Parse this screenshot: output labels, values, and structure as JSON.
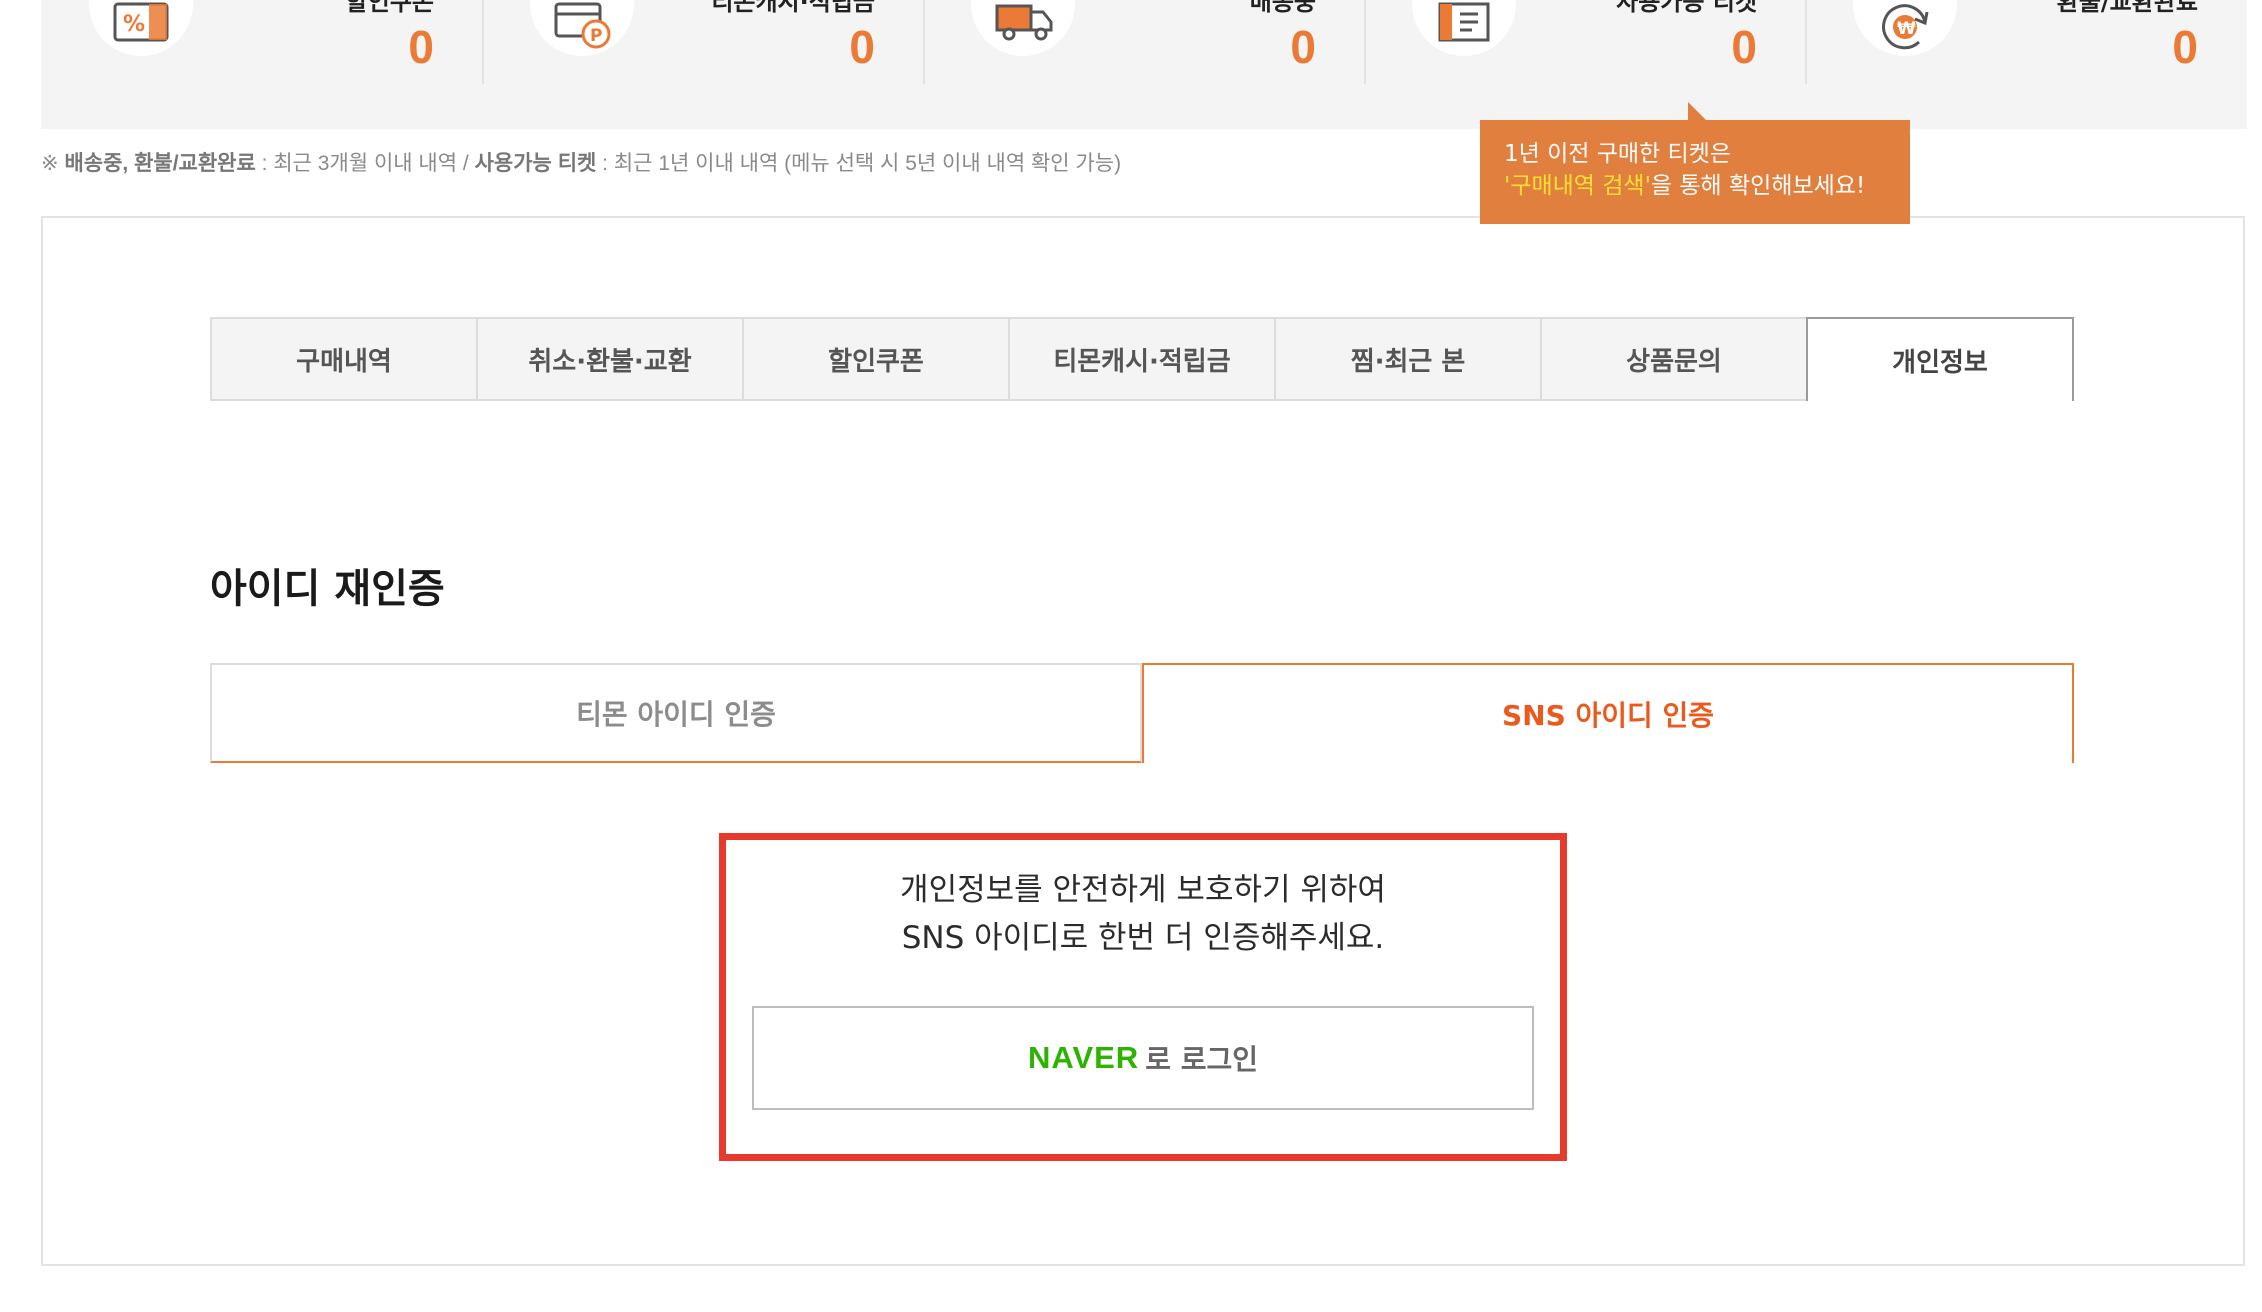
{
  "stats": [
    {
      "label": "할인쿠폰",
      "count": "0",
      "icon": "coupon-icon"
    },
    {
      "label": "티몬캐시·적립금",
      "count": "0",
      "icon": "point-card-icon"
    },
    {
      "label": "배송중",
      "count": "0",
      "icon": "truck-icon"
    },
    {
      "label": "사용가능 티켓",
      "count": "0",
      "icon": "ticket-icon"
    },
    {
      "label": "환불/교환완료",
      "count": "0",
      "icon": "refund-won-icon"
    }
  ],
  "note": {
    "prefix": "※ ",
    "bold1": "배송중, 환불/교환완료",
    "text1": " : 최근 3개월 이내 내역 / ",
    "bold2": "사용가능 티켓",
    "text2": " : 최근 1년 이내 내역 (메뉴 선택 시 5년 이내 내역 확인 가능)"
  },
  "tooltip": {
    "line1": "1년 이전 구매한 티켓은",
    "highlight": "'구매내역 검색'",
    "line2_rest": "을 통해 확인해보세요!"
  },
  "tabs": [
    {
      "label": "구매내역"
    },
    {
      "label": "취소·환불·교환"
    },
    {
      "label": "할인쿠폰"
    },
    {
      "label": "티몬캐시·적립금"
    },
    {
      "label": "찜·최근 본"
    },
    {
      "label": "상품문의"
    },
    {
      "label": "개인정보"
    }
  ],
  "section_title": "아이디 재인증",
  "subtabs": [
    {
      "label": "티몬 아이디 인증"
    },
    {
      "label": "SNS 아이디 인증"
    }
  ],
  "auth": {
    "line1": "개인정보를 안전하게 보호하기 위하여",
    "line2": "SNS 아이디로 한번 더 인증해주세요.",
    "naver_logo": "NAVER",
    "naver_text": "로 로그인"
  },
  "colors": {
    "accent": "#ea7a35",
    "highlight_box": "#e83a2c",
    "naver_green": "#2db400",
    "tooltip_bg": "#e07f3e"
  }
}
